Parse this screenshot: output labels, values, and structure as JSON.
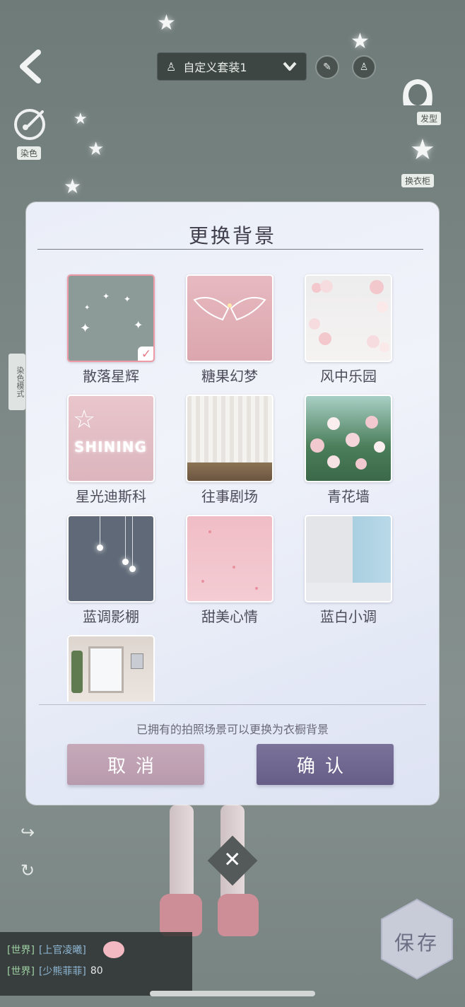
{
  "header": {
    "outfit_label": "自定义套装1",
    "round_btn_1_icon": "hand-icon",
    "round_btn_2_icon": "bottle-icon"
  },
  "side": {
    "dye_label": "染色",
    "hair_label": "发型",
    "wardrobe_label": "换衣柜",
    "dye_vertical": "染色模式"
  },
  "modal": {
    "title": "更换背景",
    "hint": "已拥有的拍照场景可以更换为衣橱背景",
    "cancel_label": "取消",
    "confirm_label": "确认",
    "selected_index": 0,
    "backgrounds": [
      {
        "label": "散落星辉",
        "selected": true
      },
      {
        "label": "糖果幻梦",
        "selected": false
      },
      {
        "label": "风中乐园",
        "selected": false
      },
      {
        "label": "星光迪斯科",
        "selected": false,
        "thumb_text": "SHINING"
      },
      {
        "label": "往事剧场",
        "selected": false
      },
      {
        "label": "青花墙",
        "selected": false
      },
      {
        "label": "蓝调影棚",
        "selected": false
      },
      {
        "label": "甜美心情",
        "selected": false
      },
      {
        "label": "蓝白小调",
        "selected": false
      },
      {
        "label": "",
        "selected": false
      }
    ]
  },
  "chat": [
    {
      "channel": "[世界]",
      "text": "[上官凌曦]"
    },
    {
      "channel": "[世界]",
      "text": "[少熊菲菲]",
      "extra": "80"
    }
  ],
  "save_label": "保存",
  "close_icon": "close-icon",
  "colors": {
    "accent_pink": "#ee9aa7",
    "cancel_btn": "#c1a4b5",
    "confirm_btn": "#716990"
  }
}
